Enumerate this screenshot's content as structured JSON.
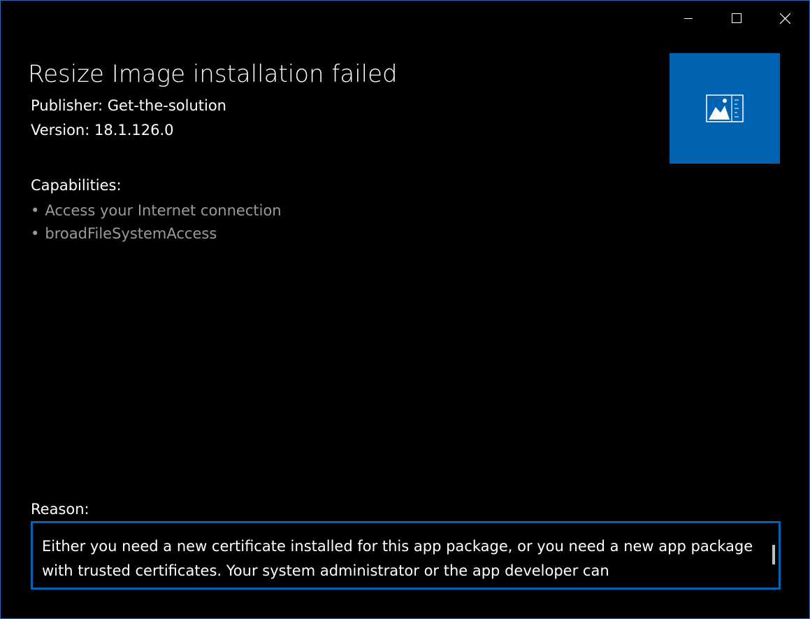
{
  "window": {
    "caption_buttons": [
      "minimize-icon",
      "maximize-icon",
      "close-icon"
    ]
  },
  "header": {
    "title": "Resize Image installation failed",
    "publisher": "Publisher: Get-the-solution",
    "version": "Version: 18.1.126.0"
  },
  "app_tile": {
    "icon": "resize-image-icon",
    "background_color": "#0063b1"
  },
  "capabilities": {
    "heading": "Capabilities:",
    "items": [
      "Access your Internet connection",
      "broadFileSystemAccess"
    ],
    "bullet": "•"
  },
  "reason": {
    "heading": "Reason:",
    "text": "Either you need a new certificate installed for this app package, or you need a new app package with trusted certificates. Your system administrator or the app developer can"
  },
  "colors": {
    "accent": "#0063b1",
    "window_border": "#2b6cb3",
    "secondary_text": "#9a9a9a"
  }
}
